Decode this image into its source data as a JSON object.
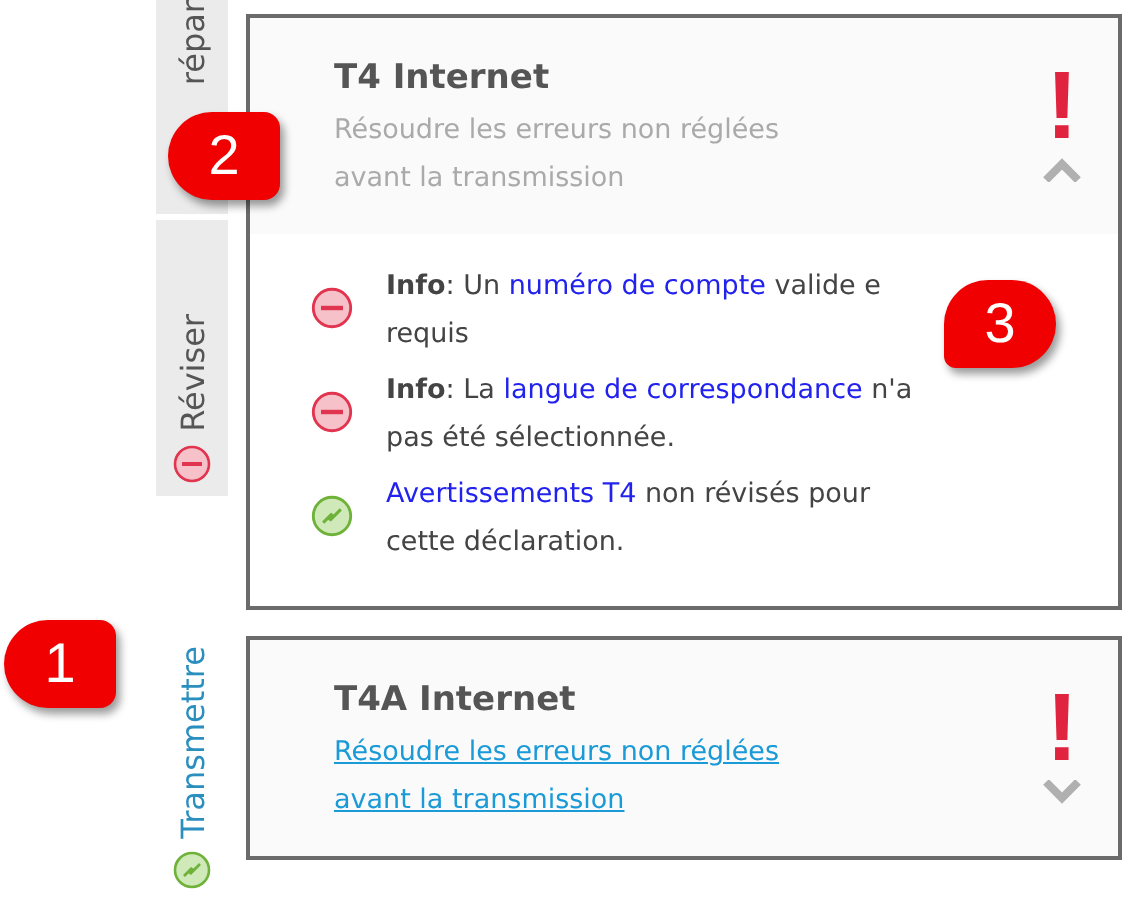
{
  "tabs": [
    {
      "label": "répar",
      "kind": "plain",
      "selected": false
    },
    {
      "label": "Réviser",
      "kind": "error",
      "selected": false
    },
    {
      "label": "Transmettre",
      "kind": "ok",
      "selected": true
    }
  ],
  "panels": [
    {
      "title": "T4 Internet",
      "subtitle": "Résoudre les erreurs non réglées\navant la transmission",
      "subtitle_link": false,
      "alert": "!",
      "expanded": true,
      "messages": [
        {
          "kind": "error",
          "parts": [
            {
              "text": "Info",
              "kind": "bold"
            },
            {
              "text": ": Un ",
              "kind": "plain"
            },
            {
              "text": "numéro de compte",
              "kind": "link"
            },
            {
              "text": " valide e\nrequis",
              "kind": "plain"
            }
          ]
        },
        {
          "kind": "error",
          "parts": [
            {
              "text": "Info",
              "kind": "bold"
            },
            {
              "text": ": La ",
              "kind": "plain"
            },
            {
              "text": "langue de correspondance",
              "kind": "link"
            },
            {
              "text": " n'a\npas été sélectionnée.",
              "kind": "plain"
            }
          ]
        },
        {
          "kind": "ok",
          "parts": [
            {
              "text": "Avertissements T4",
              "kind": "link"
            },
            {
              "text": " non révisés pour\ncette déclaration.",
              "kind": "plain"
            }
          ]
        }
      ]
    },
    {
      "title": "T4A Internet",
      "subtitle": "Résoudre les erreurs non réglées\navant la transmission",
      "subtitle_link": true,
      "alert": "!",
      "expanded": false
    }
  ],
  "callouts": [
    {
      "label": "1"
    },
    {
      "label": "2"
    },
    {
      "label": "3"
    }
  ]
}
